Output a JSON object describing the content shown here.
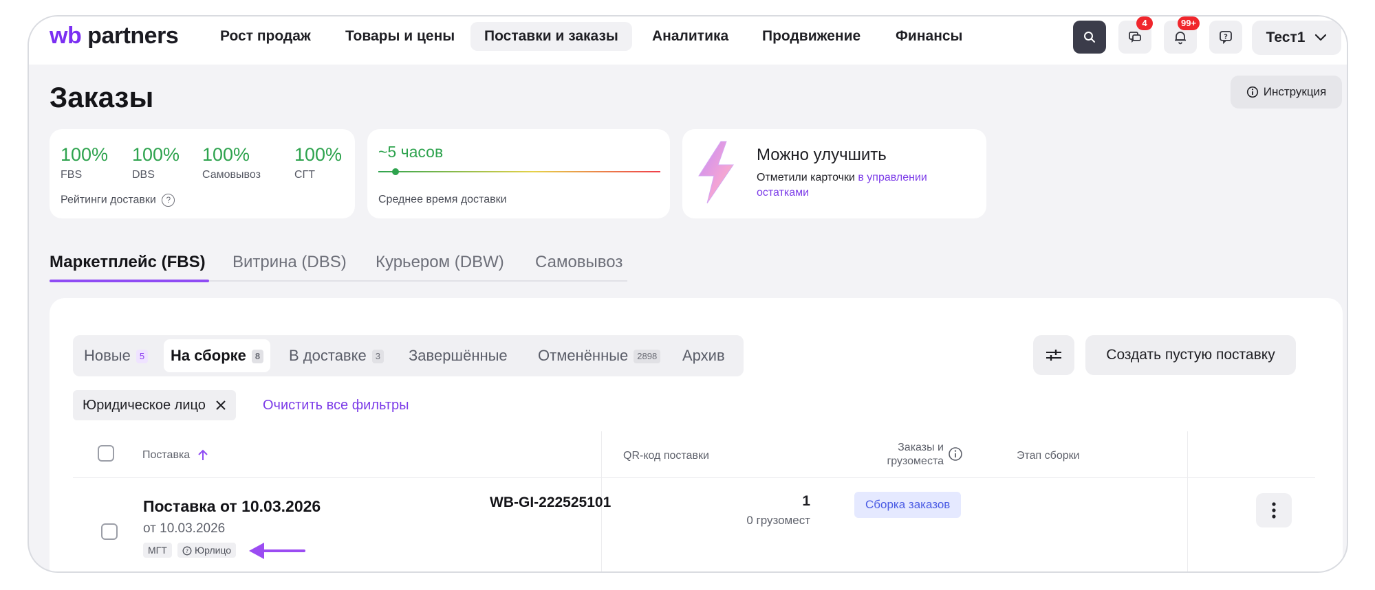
{
  "logo": {
    "wb": "wb",
    "partners": "partners"
  },
  "nav": [
    {
      "label": "Рост продаж"
    },
    {
      "label": "Товары и цены"
    },
    {
      "label": "Поставки и заказы"
    },
    {
      "label": "Аналитика"
    },
    {
      "label": "Продвижение"
    },
    {
      "label": "Финансы"
    }
  ],
  "header_icons": {
    "messages_badge": "4",
    "notifications_badge": "99+"
  },
  "user": {
    "name": "Тест1"
  },
  "page": {
    "title": "Заказы",
    "instruction": "Инструкция"
  },
  "ratings": {
    "items": [
      {
        "value": "100%",
        "label": "FBS"
      },
      {
        "value": "100%",
        "label": "DBS"
      },
      {
        "value": "100%",
        "label": "Самовывоз"
      },
      {
        "value": "100%",
        "label": "СГТ"
      }
    ],
    "caption": "Рейтинги доставки"
  },
  "delivery_time": {
    "value": "~5 часов",
    "caption": "Среднее время доставки",
    "level": 0.05
  },
  "improve": {
    "title": "Можно улучшить",
    "text": "Отметили карточки",
    "link": "в управлении остатками"
  },
  "delivery_tabs": [
    {
      "label": "Маркетплейс (FBS)"
    },
    {
      "label": "Витрина (DBS)"
    },
    {
      "label": "Курьером (DBW)"
    },
    {
      "label": "Самовывоз"
    }
  ],
  "status_tabs": [
    {
      "label": "Новые",
      "count": "5"
    },
    {
      "label": "На сборке",
      "count": "8"
    },
    {
      "label": "В доставке",
      "count": "3"
    },
    {
      "label": "Завершённые"
    },
    {
      "label": "Отменённые",
      "count": "2898"
    },
    {
      "label": "Архив"
    }
  ],
  "create_button": "Создать пустую поставку",
  "filter_chip": "Юридическое лицо",
  "clear_filters": "Очистить все фильтры",
  "table": {
    "headers": {
      "supply": "Поставка",
      "qr": "QR-код поставки",
      "orders_line1": "Заказы и",
      "orders_line2": "грузоместа",
      "stage": "Этап сборки"
    },
    "rows": [
      {
        "title": "Поставка от 10.03.2026",
        "date": "от 10.03.2026",
        "tags": [
          "МГТ",
          "Юрлицо"
        ],
        "qr": "WB-GI-222525101",
        "orders": "1",
        "places": "0 грузомест",
        "stage": "Сборка заказов"
      }
    ]
  },
  "colors": {
    "accent": "#8f4cf4",
    "green": "#2ea34e",
    "badge": "#f0262c",
    "stage": "#4a5be4"
  }
}
